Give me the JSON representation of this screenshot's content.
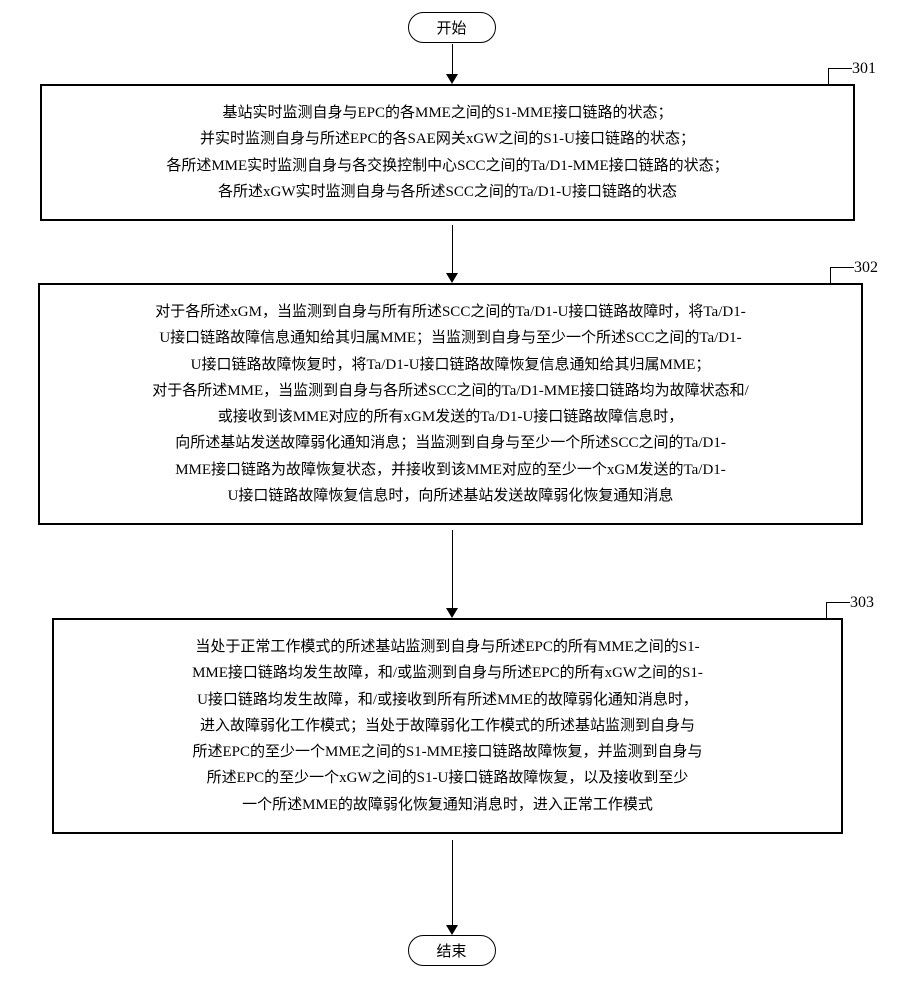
{
  "flow": {
    "start": "开始",
    "end": "结束",
    "steps": {
      "s301": {
        "ref": "301",
        "lines": [
          "基站实时监测自身与EPC的各MME之间的S1-MME接口链路的状态；",
          "并实时监测自身与所述EPC的各SAE网关xGW之间的S1-U接口链路的状态；",
          "各所述MME实时监测自身与各交换控制中心SCC之间的Ta/D1-MME接口链路的状态；",
          "各所述xGW实时监测自身与各所述SCC之间的Ta/D1-U接口链路的状态"
        ]
      },
      "s302": {
        "ref": "302",
        "lines": [
          "对于各所述xGM，当监测到自身与所有所述SCC之间的Ta/D1-U接口链路故障时，将Ta/D1-",
          "U接口链路故障信息通知给其归属MME；当监测到自身与至少一个所述SCC之间的Ta/D1-",
          "U接口链路故障恢复时，将Ta/D1-U接口链路故障恢复信息通知给其归属MME；",
          "对于各所述MME，当监测到自身与各所述SCC之间的Ta/D1-MME接口链路均为故障状态和/",
          "或接收到该MME对应的所有xGM发送的Ta/D1-U接口链路故障信息时，",
          "向所述基站发送故障弱化通知消息；当监测到自身与至少一个所述SCC之间的Ta/D1-",
          "MME接口链路为故障恢复状态，并接收到该MME对应的至少一个xGM发送的Ta/D1-",
          "U接口链路故障恢复信息时，向所述基站发送故障弱化恢复通知消息"
        ]
      },
      "s303": {
        "ref": "303",
        "lines": [
          "当处于正常工作模式的所述基站监测到自身与所述EPC的所有MME之间的S1-",
          "MME接口链路均发生故障，和/或监测到自身与所述EPC的所有xGW之间的S1-",
          "U接口链路均发生故障，和/或接收到所有所述MME的故障弱化通知消息时，",
          "进入故障弱化工作模式；当处于故障弱化工作模式的所述基站监测到自身与",
          "所述EPC的至少一个MME之间的S1-MME接口链路故障恢复，并监测到自身与",
          "所述EPC的至少一个xGW之间的S1-U接口链路故障恢复，以及接收到至少",
          "一个所述MME的故障弱化恢复通知消息时，进入正常工作模式"
        ]
      }
    }
  }
}
